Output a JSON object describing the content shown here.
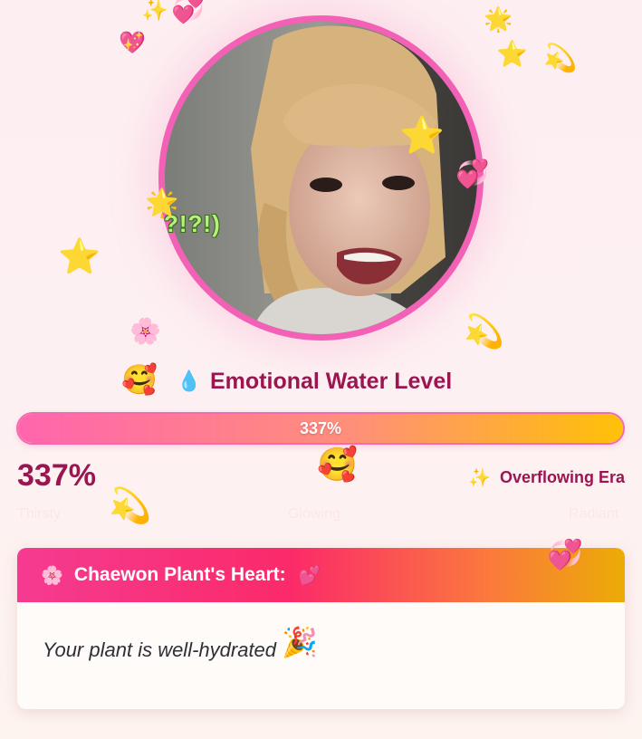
{
  "avatar": {
    "caption": "?!?!)"
  },
  "title": {
    "face_icon": "🥰",
    "drop_icon": "💧",
    "text": "Emotional Water Level"
  },
  "meter": {
    "value_percent": 337,
    "fill_fraction": 1.0,
    "label": "337%",
    "big_value": "337%",
    "status_icon": "✨",
    "status_text": "Overflowing Era",
    "scale": [
      "Thirsty",
      "Glowing",
      "Radiant"
    ]
  },
  "card": {
    "flower_icon": "🌸",
    "title": "Chaewon Plant's Heart:",
    "hearts_icon": "💕",
    "message": "Your plant is well-hydrated",
    "party_icon": "🎉"
  },
  "decorations": {
    "star": "⭐",
    "sparkles": "✨",
    "revolving_hearts": "💞",
    "heart": "💖",
    "dizzy": "💫",
    "glowing_star": "🌟",
    "blossom": "🌸",
    "smiling_hearts": "🥰"
  },
  "colors": {
    "accent_pink": "#f261b5",
    "title_maroon": "#9b1551",
    "bar_start": "#ff65ad",
    "bar_end": "#ffc107"
  }
}
